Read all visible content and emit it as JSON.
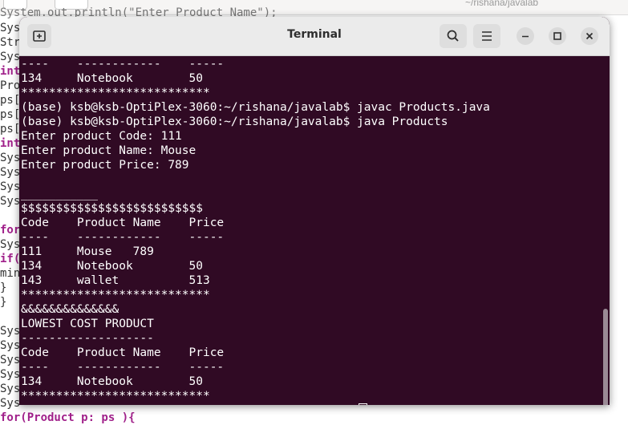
{
  "background": {
    "path": "~/rishana/javalab",
    "top_fragment": "System.out.println(\"Enter Product Name\");",
    "left_fragments": [
      "Sys",
      "Str",
      "Sys",
      "int",
      "Pro",
      "ps[",
      "ps[",
      "ps[",
      "int",
      "Sys",
      "Sys",
      "Sys",
      "Sys",
      "",
      "for",
      "Sys",
      "if(",
      "min",
      "}",
      "}",
      "",
      "Sys",
      "Sys",
      "Sys",
      "Sys",
      "Sys",
      "Sys"
    ],
    "bottom_fragment": "for(Product p: ps ){"
  },
  "terminal": {
    "title": "Terminal",
    "lines": [
      "----    ------------    -----",
      "134     Notebook        50",
      "***************************",
      "(base) ksb@ksb-OptiPlex-3060:~/rishana/javalab$ javac Products.java",
      "(base) ksb@ksb-OptiPlex-3060:~/rishana/javalab$ java Products",
      "Enter product Code: 111",
      "Enter product Name: Mouse",
      "Enter product Price: 789",
      "",
      "___________",
      "$$$$$$$$$$$$$$$$$$$$$$$$$$",
      "Code    Product Name    Price",
      "----    ------------    -----",
      "111     Mouse   789",
      "134     Notebook        50",
      "143     wallet          513",
      "***************************",
      "&&&&&&&&&&&&&&",
      "LOWEST COST PRODUCT",
      "-------------------",
      "Code    Product Name    Price",
      "----    ------------    -----",
      "134     Notebook        50",
      "***************************"
    ],
    "prompt": "(base) ksb@ksb-OptiPlex-3060:~/rishana/javalab$ "
  },
  "icons": {
    "new_tab": "new-tab-icon",
    "search": "search-icon",
    "menu": "hamburger-menu-icon",
    "minimize": "minimize-icon",
    "maximize": "maximize-icon",
    "close": "close-icon"
  },
  "colors": {
    "terminal_bg": "#300a24",
    "terminal_fg": "#ffffff",
    "headerbar_bg": "#ebebeb"
  }
}
